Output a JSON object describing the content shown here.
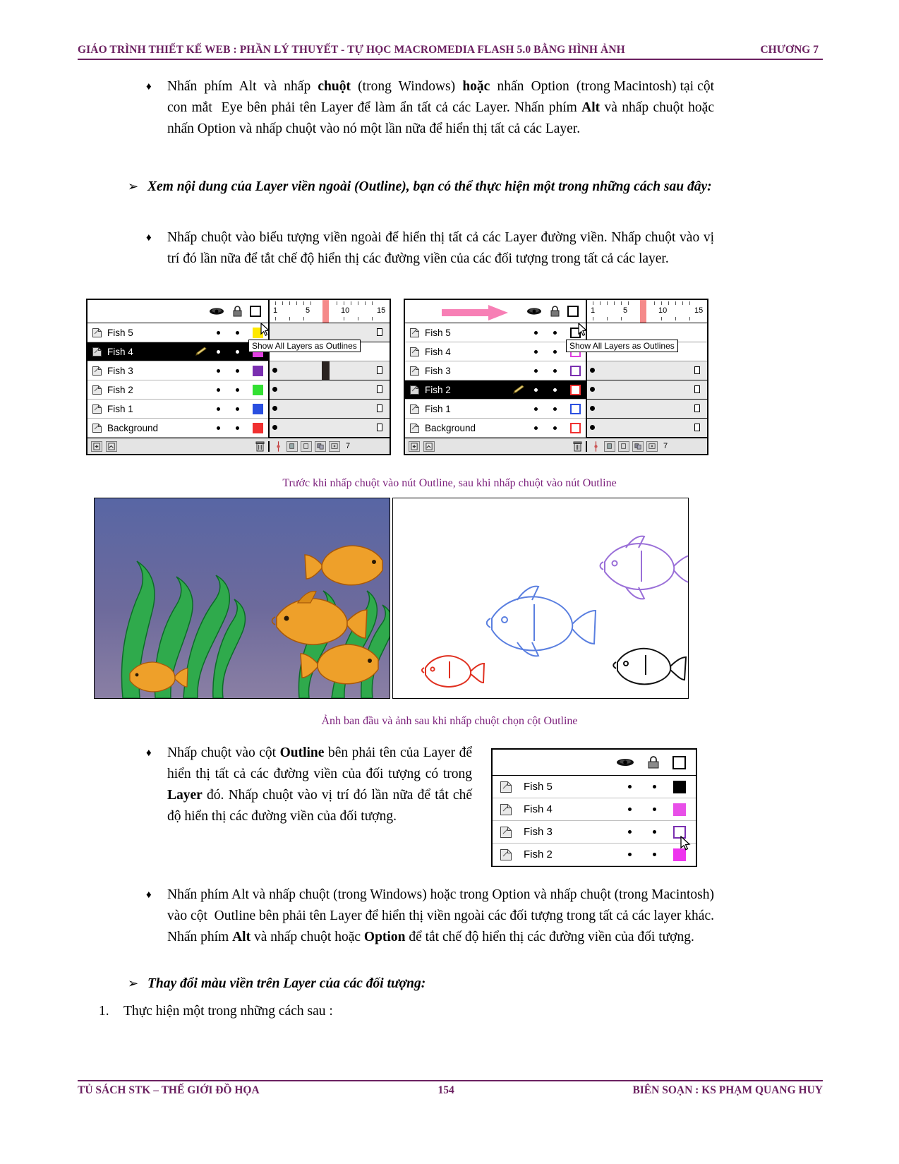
{
  "header": {
    "title": "GIÁO TRÌNH THIẾT KẾ WEB : PHẦN LÝ THUYẾT  -  TỰ HỌC MACROMEDIA FLASH 5.0 BẰNG HÌNH ẢNH",
    "chapter": "CHƯƠNG 7"
  },
  "footer": {
    "left": "TỦ SÁCH STK – THẾ GIỚI ĐỒ HỌA",
    "page": "154",
    "right": "BIÊN SOẠN : KS PHẠM QUANG HUY"
  },
  "body": {
    "bullet1_marker": "♦",
    "bullet1": "Nhấn phím Alt và nhấp chuột (trong Windows) hoặc nhấn Option (trong Macintosh) tại cột con mắt  Eye bên phải tên Layer để làm ẩn tất cả các Layer. Nhấn phím Alt và nhấp chuột hoặc nhấn Option và nhấp chuột vào nó một lần nữa để hiển thị tất cả các Layer.",
    "bullet1_bold": "Alt",
    "subhead1_marker": "➢",
    "subhead1": "Xem nội dung của Layer viền ngoài (Outline), bạn có thể thực hiện một trong những cách sau đây:",
    "bullet2_marker": "♦",
    "bullet2": "Nhấp chuột vào biểu tượng viền ngoài để hiển thị tất cả các Layer đường viền. Nhấp chuột vào vị trí đó lần nữa để tắt chế độ hiển thị các đường viền của các đối tượng trong tất cả các layer.",
    "caption1": "Trước khi nhấp chuột vào nút Outline, sau khi nhấp chuột vào nút Outline",
    "caption2": "Ảnh ban đầu và ảnh sau khi nhấp chuột chọn cột Outline",
    "bullet3_marker": "♦",
    "bullet3_part1": "Nhấp chuột vào cột ",
    "bullet3_bold1": "Outline",
    "bullet3_part2": " bên phải tên của Layer để hiển thị tất cả các đường viền của đối tượng có trong ",
    "bullet3_bold2": "Layer",
    "bullet3_part3": " đó. Nhấp chuột vào vị trí đó lần nữa để tắt chế độ hiển thị các đường viền của đối tượng.",
    "bullet4_marker": "♦",
    "bullet4": "Nhấn phím Alt và nhấp chuột (trong Windows) hoặc trong Option và nhấp chuột (trong Macintosh) vào cột  Outline bên phải tên Layer để hiển thị viền ngoài các đối tượng trong tất cả các layer khác. Nhấn phím Alt và nhấp chuột hoặc Option để tắt chế độ hiển thị các đường viền của đối tượng.",
    "bullet4_bold1": "Alt",
    "bullet4_bold2": "Option",
    "subhead2_marker": "➢",
    "subhead2": "Thay đổi màu viền trên Layer của các  đối tượng:",
    "item1_num": "1.",
    "item1": "Thực hiện một trong những cách sau :"
  },
  "timeline_left": {
    "tooltip": "Show All Layers as Outlines",
    "outline_button_state": "solid",
    "ruler_labels": [
      "1",
      "5",
      "10",
      "15"
    ],
    "frame_count": "7",
    "layers": [
      {
        "name": "Fish 5",
        "color": "#ffe800",
        "outline": false,
        "selected": false,
        "pencil": false
      },
      {
        "name": "Fish 4",
        "color": "#e040e0",
        "outline": false,
        "selected": true,
        "pencil": true
      },
      {
        "name": "Fish 3",
        "color": "#7a2fb0",
        "outline": false,
        "selected": false,
        "pencil": false
      },
      {
        "name": "Fish 2",
        "color": "#33e033",
        "outline": false,
        "selected": false,
        "pencil": false
      },
      {
        "name": "Fish 1",
        "color": "#2a4fe0",
        "outline": false,
        "selected": false,
        "pencil": false
      },
      {
        "name": "Background",
        "color": "#f03030",
        "outline": false,
        "selected": false,
        "pencil": false
      }
    ]
  },
  "timeline_right": {
    "tooltip": "Show All Layers as Outlines",
    "outline_button_state": "outline",
    "ruler_labels": [
      "1",
      "5",
      "10",
      "15"
    ],
    "frame_count": "7",
    "layers": [
      {
        "name": "Fish 5",
        "color": "#000000",
        "outline": true,
        "selected": false,
        "pencil": false
      },
      {
        "name": "Fish 4",
        "color": "#e040e0",
        "outline": true,
        "selected": false,
        "pencil": false
      },
      {
        "name": "Fish 3",
        "color": "#7a2fb0",
        "outline": true,
        "selected": false,
        "pencil": false
      },
      {
        "name": "Fish 2",
        "color": "#f03030",
        "outline": true,
        "selected": true,
        "pencil": true
      },
      {
        "name": "Fish 1",
        "color": "#2a4fe0",
        "outline": true,
        "selected": false,
        "pencil": false
      },
      {
        "name": "Background",
        "color": "#f03030",
        "outline": true,
        "selected": false,
        "pencil": false
      }
    ]
  },
  "small_panel": {
    "layers": [
      {
        "name": "Fish 5",
        "color": "#000000",
        "filled": true
      },
      {
        "name": "Fish 4",
        "color": "#e84fe8",
        "filled": true
      },
      {
        "name": "Fish 3",
        "color": "#7a2fb0",
        "filled": false
      },
      {
        "name": "Fish 2",
        "color": "#ee33ee",
        "filled": true
      }
    ]
  },
  "artwork": {
    "left_title": "aquarium-scene-colored",
    "right_title": "aquarium-scene-outlines",
    "left_bg_top": "#5c6fa8",
    "left_bg_bottom": "#7a6f9a",
    "plant_color": "#2faa4c",
    "fish_orange": "#e8901a",
    "outline_fish_colors": [
      "#9a6fd8",
      "#5a7fe0",
      "#e03020",
      "#000000"
    ]
  },
  "colors": {
    "heading_purple": "#6b2060",
    "caption_purple": "#7b1f7b",
    "pink_arrow": "#f77fb5",
    "playhead": "#f58a8a"
  }
}
